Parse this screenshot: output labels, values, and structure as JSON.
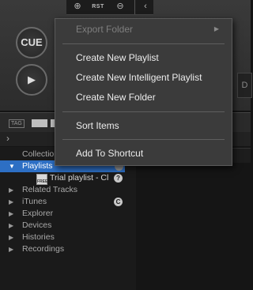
{
  "player": {
    "zoom_in_symbol": "⊕",
    "reset_label": "RST",
    "zoom_out_symbol": "⊖",
    "back_symbol": "‹",
    "cue_label": "CUE",
    "play_symbol": "▶",
    "right_edge_char": "D"
  },
  "tag_row": {
    "tag_label": "TAG"
  },
  "tree": {
    "collapse_symbol": "›",
    "items": [
      {
        "label": "Collection",
        "arrow": ""
      },
      {
        "label": "Playlists",
        "arrow": "▼"
      },
      {
        "label": "Trial playlist - Cl",
        "arrow": ""
      },
      {
        "label": "Related Tracks",
        "arrow": "▶"
      },
      {
        "label": "iTunes",
        "arrow": "▶"
      },
      {
        "label": "Explorer",
        "arrow": "▶"
      },
      {
        "label": "Devices",
        "arrow": "▶"
      },
      {
        "label": "Histories",
        "arrow": "▶"
      },
      {
        "label": "Recordings",
        "arrow": "▶"
      }
    ],
    "playlist_icon_text": "FREE",
    "help_badge": "?",
    "itunes_badge": "C"
  },
  "context_menu": {
    "export_folder": "Export Folder",
    "submenu_arrow": "▶",
    "create_playlist": "Create New Playlist",
    "create_intelligent_playlist": "Create New Intelligent Playlist",
    "create_folder": "Create New Folder",
    "sort_items": "Sort Items",
    "add_to_shortcut": "Add To Shortcut"
  },
  "colors": {
    "selection": "#2d6fc4",
    "menu_background": "#3b3b3b",
    "menu_disabled_text": "#7e7e7e"
  }
}
